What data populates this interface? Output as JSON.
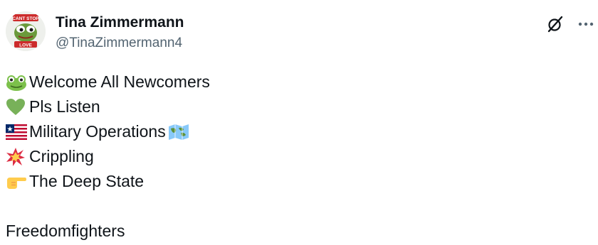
{
  "author": {
    "display_name": "Tina Zimmermann",
    "handle": "@TinaZimmermann4",
    "avatar_text_top": "CANT STOP",
    "avatar_text_bottom": "LOVE"
  },
  "actions": {
    "grok_icon": "slashed-circle-icon",
    "more_icon": "more-horizontal-icon"
  },
  "post": {
    "lines": [
      {
        "emoji": "frog-face-icon",
        "text": "Welcome All Newcomers"
      },
      {
        "emoji": "green-heart-icon",
        "text": "Pls Listen"
      },
      {
        "emoji": "liberia-flag-icon",
        "text": "Military Operations",
        "trailing_emoji": "world-map-icon"
      },
      {
        "emoji": "collision-icon",
        "text": "Crippling"
      },
      {
        "emoji": "backhand-pointing-right-icon",
        "text": "The Deep State"
      }
    ],
    "footer_text": "Freedomfighters"
  },
  "colors": {
    "text": "#0f1419",
    "secondary_text": "#536471",
    "background": "#ffffff"
  }
}
